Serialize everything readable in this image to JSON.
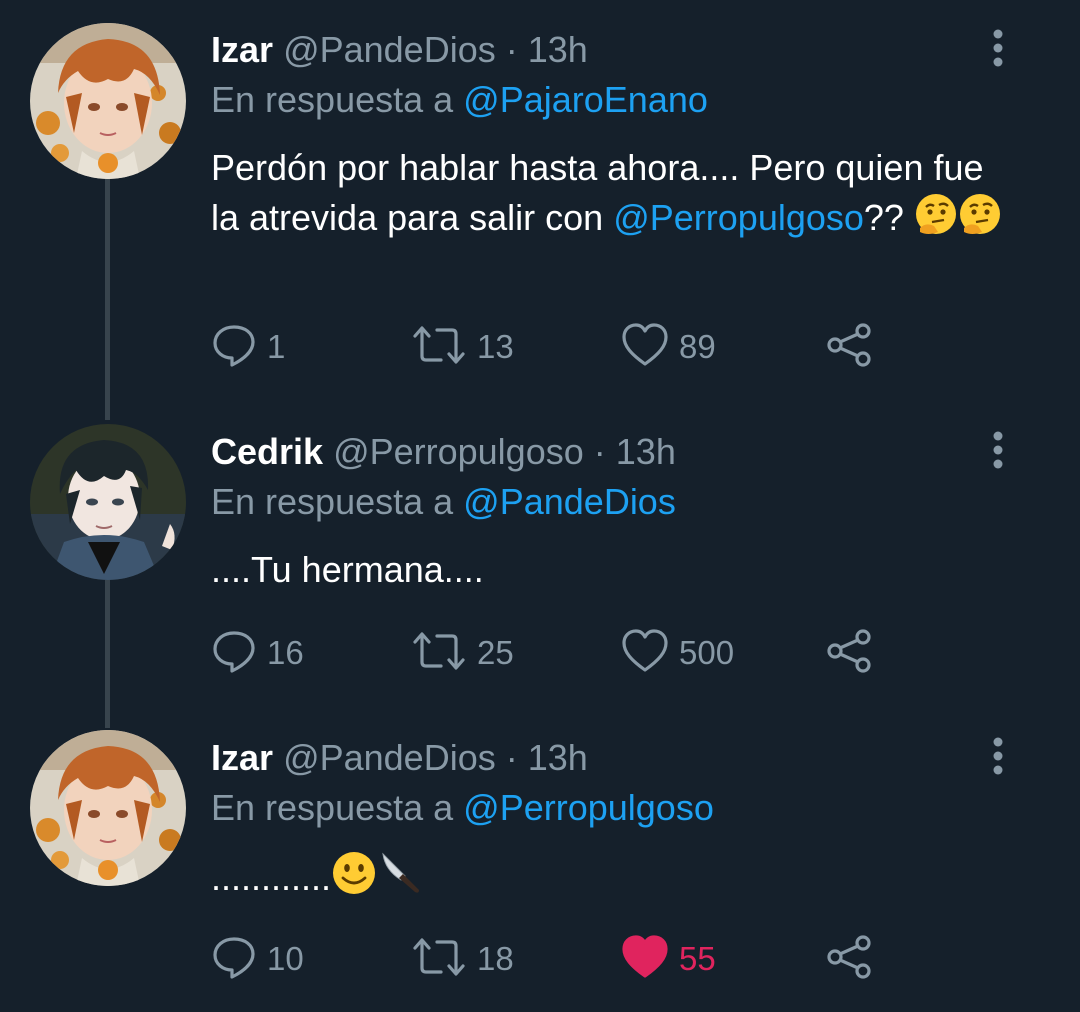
{
  "tweets": [
    {
      "author_name": "Izar",
      "handle": "@PandeDios",
      "separator": "·",
      "time": "13h",
      "reply_prefix": "En respuesta a",
      "reply_to": "@PajaroEnano",
      "text_before": "Perdón por hablar hasta ahora.... Pero quien fue la atrevida para salir con ",
      "text_mention": "@Perropulgoso",
      "text_after": "?? ",
      "emojis": [
        "thinking-face-emoji",
        "thinking-face-emoji"
      ],
      "reply_count": "1",
      "retweet_count": "13",
      "like_count": "89",
      "liked": false,
      "avatar": "orange-hair-avatar"
    },
    {
      "author_name": "Cedrik",
      "handle": "@Perropulgoso",
      "separator": "·",
      "time": "13h",
      "reply_prefix": "En respuesta a",
      "reply_to": "@PandeDios",
      "text": "....Tu hermana....",
      "reply_count": "16",
      "retweet_count": "25",
      "like_count": "500",
      "liked": false,
      "avatar": "dark-hair-avatar"
    },
    {
      "author_name": "Izar",
      "handle": "@PandeDios",
      "separator": "·",
      "time": "13h",
      "reply_prefix": "En respuesta a",
      "reply_to": "@Perropulgoso",
      "text": "............",
      "emojis": [
        "slightly-smiling-face-emoji",
        "knife-emoji"
      ],
      "reply_count": "10",
      "retweet_count": "18",
      "like_count": "55",
      "liked": true,
      "avatar": "orange-hair-avatar"
    }
  ],
  "colors": {
    "background": "#15202b",
    "text_primary": "#ffffff",
    "text_secondary": "#8899a6",
    "link": "#1da1f2",
    "like_active": "#e0245e",
    "thread_line": "#38444d"
  },
  "icons": {
    "reply": "reply-icon",
    "retweet": "retweet-icon",
    "like": "heart-icon",
    "share": "share-icon",
    "menu": "more-vertical-icon"
  }
}
